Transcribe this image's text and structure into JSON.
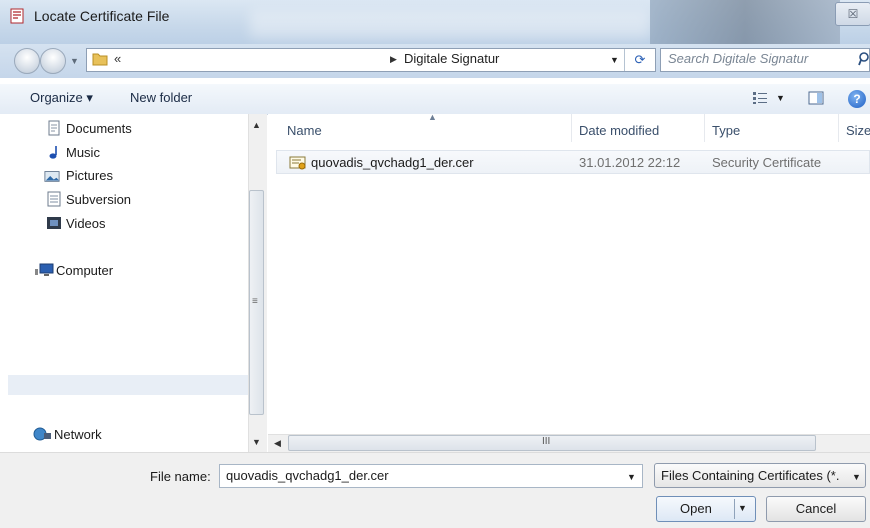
{
  "window": {
    "title": "Locate Certificate File",
    "close_glyph": "☒"
  },
  "address": {
    "chevrons": "«",
    "current_folder": "Digitale Signatur"
  },
  "search": {
    "placeholder": "Search Digitale Signatur"
  },
  "toolbar": {
    "organize": "Organize ▾",
    "new_folder": "New folder"
  },
  "nav": {
    "items": [
      {
        "label": "Documents",
        "icon": "documents-icon"
      },
      {
        "label": "Music",
        "icon": "music-icon"
      },
      {
        "label": "Pictures",
        "icon": "pictures-icon"
      },
      {
        "label": "Subversion",
        "icon": "subversion-icon"
      },
      {
        "label": "Videos",
        "icon": "videos-icon"
      },
      {
        "label": "Computer",
        "icon": "computer-icon"
      },
      {
        "label": "Network",
        "icon": "network-icon"
      }
    ]
  },
  "columns": {
    "name": "Name",
    "date": "Date modified",
    "type": "Type",
    "size": "Size"
  },
  "files": [
    {
      "name": "quovadis_qvchadg1_der.cer",
      "date": "31.01.2012 22:12",
      "type": "Security Certificate"
    }
  ],
  "bottom": {
    "file_name_label": "File name:",
    "file_name_value": "quovadis_qvchadg1_der.cer",
    "filter": "Files Containing Certificates (*.",
    "open": "Open",
    "cancel": "Cancel"
  },
  "colors": {
    "titlebar": "#c7d8ea",
    "selection": "#eef2f7",
    "help": "#1e5fc4"
  }
}
